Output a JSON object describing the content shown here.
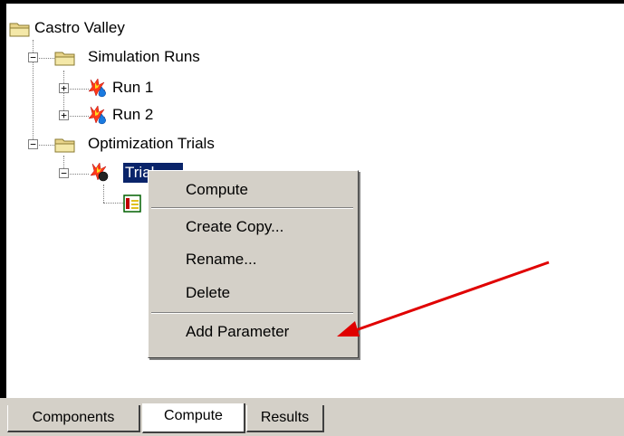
{
  "tree": {
    "root": {
      "label": "Castro Valley"
    },
    "simulation_runs": {
      "label": "Simulation Runs",
      "expander": "−"
    },
    "run1": {
      "label": "Run 1",
      "expander": "+"
    },
    "run2": {
      "label": "Run 2",
      "expander": "+"
    },
    "optimization_trials": {
      "label": "Optimization Trials",
      "expander": "−"
    },
    "trial": {
      "label": "Trial",
      "expander": "−"
    }
  },
  "context_menu": {
    "items": [
      {
        "label": "Compute"
      },
      {
        "label": "Create Copy..."
      },
      {
        "label": "Rename..."
      },
      {
        "label": "Delete"
      },
      {
        "label": "Add Parameter"
      }
    ]
  },
  "tabs": [
    {
      "label": "Components"
    },
    {
      "label": "Compute",
      "active": true
    },
    {
      "label": "Results"
    }
  ],
  "colors": {
    "selection": "#0a246a",
    "menu_bg": "#d4d0c8",
    "arrow": "#e00000"
  }
}
